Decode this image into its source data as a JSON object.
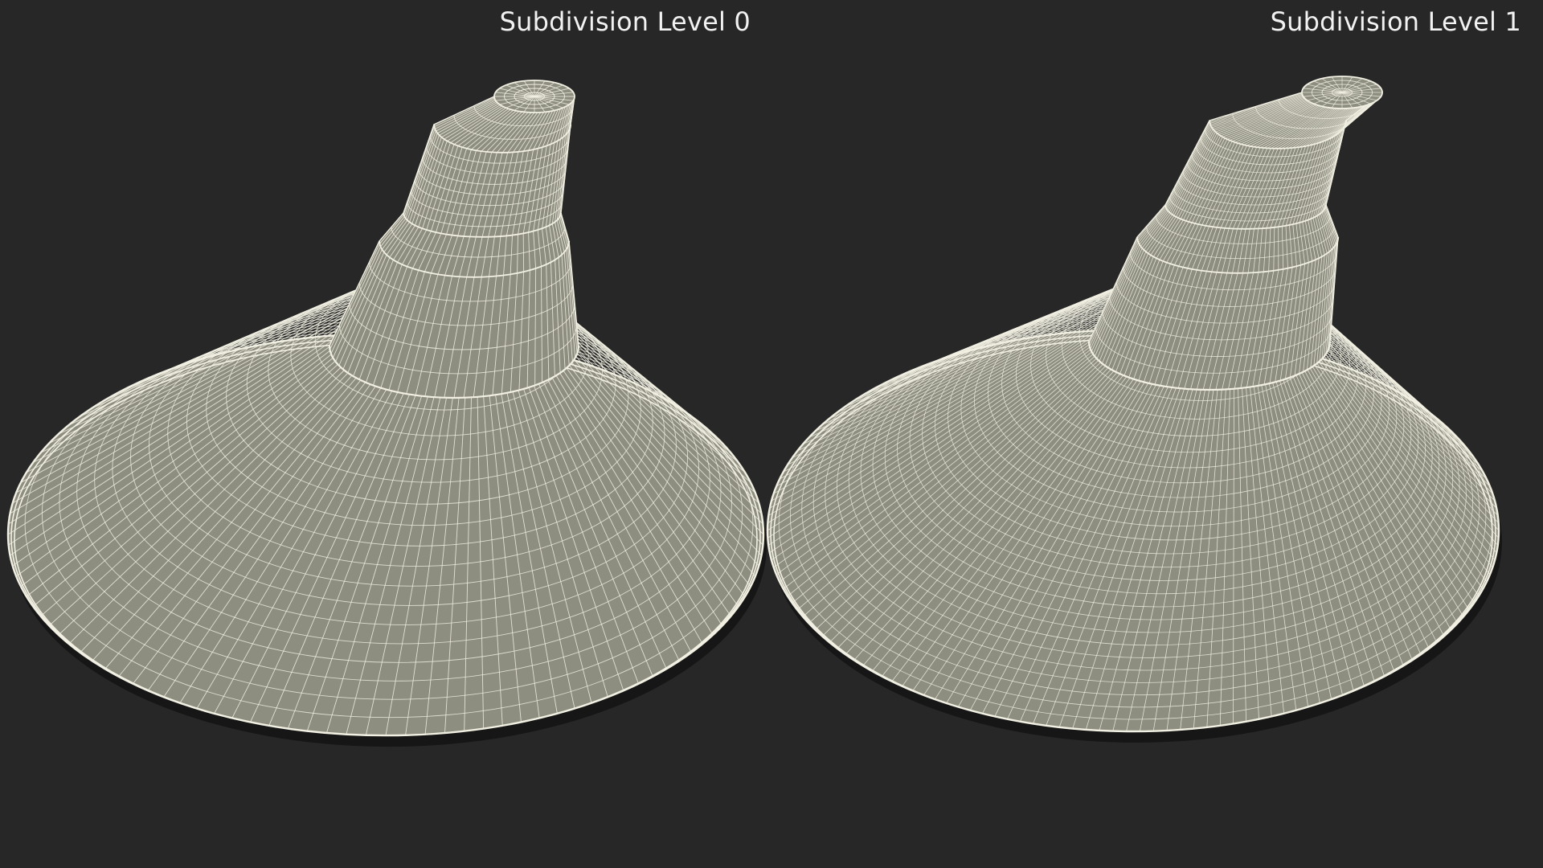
{
  "labels": {
    "left": "Subdivision Level 0",
    "right": "Subdivision Level 1"
  },
  "colors": {
    "background": "#272727",
    "mesh_fill": "#8d8d80",
    "wire": "#f1f0e2",
    "text": "#f2f2f2"
  }
}
